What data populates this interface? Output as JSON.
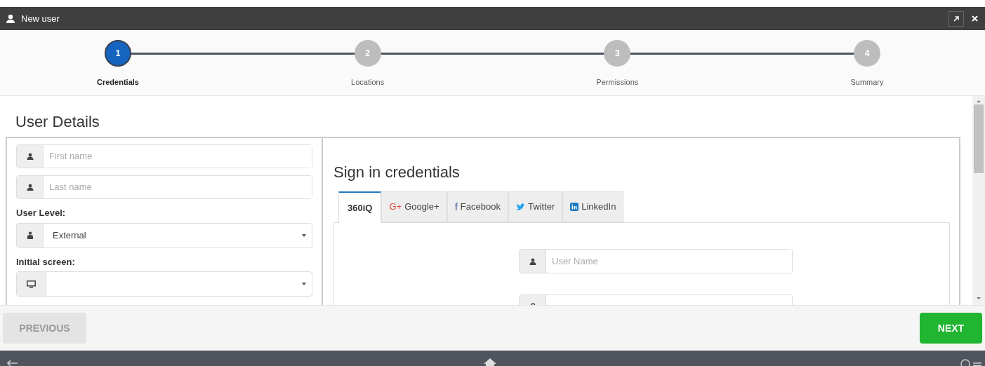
{
  "window": {
    "title": "New user"
  },
  "steps": [
    {
      "number": "1",
      "label": "Credentials",
      "selected": true
    },
    {
      "number": "2",
      "label": "Locations",
      "selected": false
    },
    {
      "number": "3",
      "label": "Permissions",
      "selected": false
    },
    {
      "number": "4",
      "label": "Summary",
      "selected": false
    }
  ],
  "section_title": "User Details",
  "user_form": {
    "first_name": {
      "placeholder": "First name"
    },
    "last_name": {
      "placeholder": "Last name"
    },
    "user_level": {
      "label": "User Level:",
      "value": "External"
    },
    "initial_screen": {
      "label": "Initial screen:"
    }
  },
  "credentials": {
    "title": "Sign in credentials",
    "tabs": [
      {
        "kind": "plain",
        "label": "360iQ",
        "selected": true
      },
      {
        "kind": "google",
        "glyph": "G+",
        "label": "Google+",
        "selected": false
      },
      {
        "kind": "facebook",
        "glyph": "f",
        "label": "Facebook",
        "selected": false
      },
      {
        "kind": "twitter",
        "label": "Twitter",
        "selected": false
      },
      {
        "kind": "linkedin",
        "label": "LinkedIn",
        "selected": false
      }
    ],
    "user_name": {
      "placeholder": "User Name"
    }
  },
  "footer": {
    "previous": {
      "label": "PREVIOUS",
      "disabled": true
    },
    "next": {
      "label": "NEXT",
      "disabled": false
    }
  }
}
